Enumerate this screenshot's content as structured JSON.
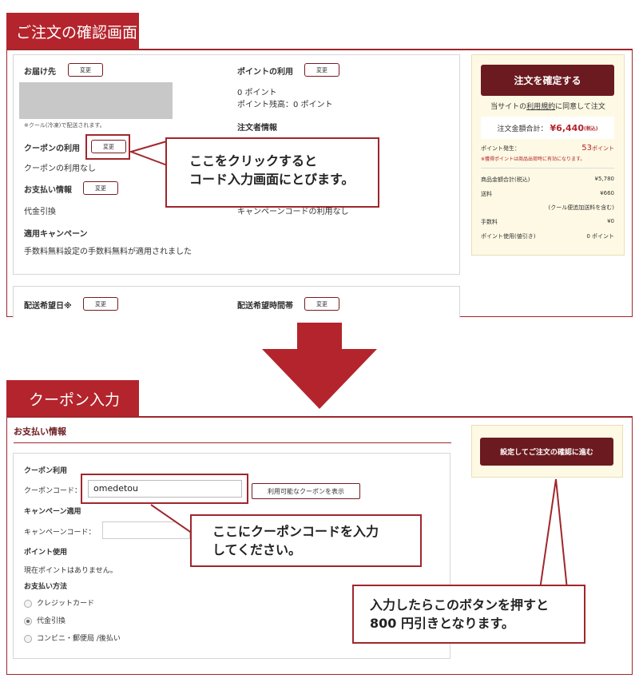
{
  "top": {
    "tab_title": "ご注文の確認画面",
    "delivery_label": "お届け先",
    "change_label": "変更",
    "cool_note": "※クール(冷凍)で配送されます。",
    "coupon_label": "クーポンの利用",
    "coupon_value": "クーポンの利用なし",
    "payment_label": "お支払い情報",
    "payment_value": "代金引換",
    "campaign_label": "適用キャンペーン",
    "campaign_value": "手数料無料設定の手数料無料が適用されました",
    "points_label": "ポイントの利用",
    "points_value": "0 ポイント",
    "points_balance": "ポイント残高：0 ポイント",
    "orderer_label": "注文者情報",
    "campaign_code_value": "キャンペーンコードの利用なし",
    "delivery_date_label": "配送希望日※",
    "delivery_time_label": "配送希望時間帯"
  },
  "summary": {
    "confirm_button": "注文を確定する",
    "terms_prefix": "当サイトの",
    "terms_link": "利用規約",
    "terms_suffix": "に同意して注文",
    "total_label": "注文金額合計：",
    "total_value": "¥6,440",
    "total_tax": "(税込)",
    "points_earned_label": "ポイント発生：",
    "points_earned_value": "53",
    "points_unit": "ポイント",
    "points_note": "※獲得ポイントは商品出荷時に有効になります。",
    "rows": [
      {
        "label": "商品金額合計(税込)",
        "value": "¥5,780"
      },
      {
        "label": "送料",
        "value": "¥660"
      },
      {
        "label": "",
        "value": "(クール便追加送料を含む)"
      },
      {
        "label": "手数料",
        "value": "¥0"
      },
      {
        "label": "ポイント使用(値引き)",
        "value": "0 ポイント"
      }
    ]
  },
  "callout1": {
    "line1": "ここをクリックすると",
    "line2": "コード入力画面にとびます。"
  },
  "bottom": {
    "tab_title": "クーポン入力",
    "section_title": "お支払い情報",
    "submit_button": "設定してご注文の確認に進む",
    "coupon_use_label": "クーポン利用",
    "coupon_code_label": "クーポンコード：",
    "coupon_code_value": "omedetou",
    "show_coupons_button": "利用可能なクーポンを表示",
    "campaign_apply_label": "キャンペーン適用",
    "campaign_code_label": "キャンペーンコード：",
    "point_use_label": "ポイント使用",
    "point_none": "現在ポイントはありません。",
    "payment_method_label": "お支払い方法",
    "methods": [
      "クレジットカード",
      "代金引換",
      "コンビニ・郵便局 /後払い"
    ]
  },
  "callout2": {
    "line1": "ここにクーポンコードを入力",
    "line2": "してください。"
  },
  "callout3": {
    "line1": "入力したらこのボタンを押すと",
    "line2": "800 円引きとなります。"
  },
  "colors": {
    "accent": "#b4242c",
    "dark_button": "#6b1a1f",
    "side_bg": "#fdf9e4"
  }
}
